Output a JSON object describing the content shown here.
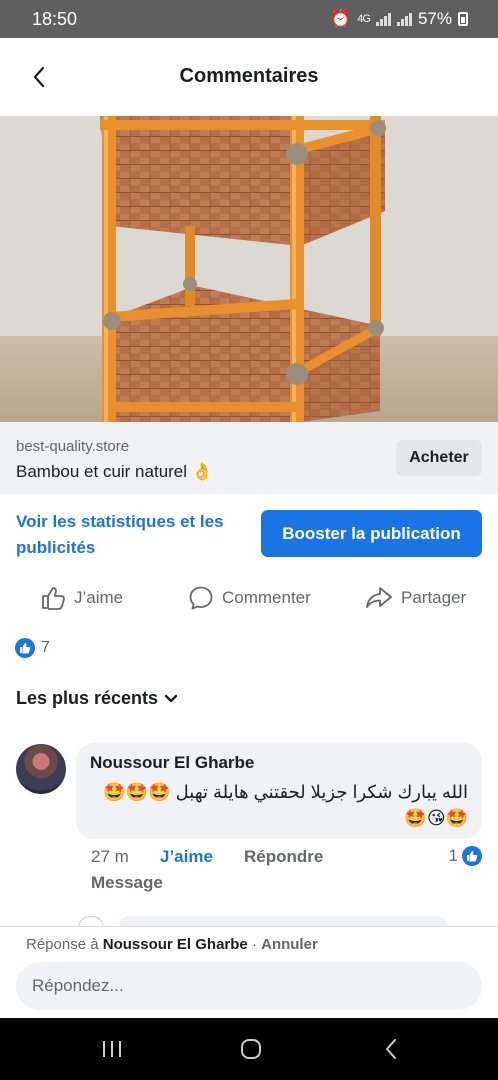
{
  "status_bar": {
    "time": "18:50",
    "network": "4G",
    "battery": "57%"
  },
  "header": {
    "title": "Commentaires"
  },
  "product": {
    "store": "best-quality.store",
    "name": "Bambou et cuir naturel 👌",
    "buy_label": "Acheter"
  },
  "promo": {
    "stats_label": "Voir les statistiques et les publicités",
    "boost_label": "Booster la publication"
  },
  "actions": {
    "like": "J’aime",
    "comment": "Commenter",
    "share": "Partager"
  },
  "reactions": {
    "count": "7"
  },
  "sort": {
    "label": "Les plus récents"
  },
  "comment": {
    "author": "Noussour El Gharbe",
    "text": "الله يبارك شكرا جزيلا لحقتني هايلة تهبل 🤩🤩🤩🤩😘🤩",
    "time": "27 m",
    "like_label": "J’aime",
    "reply_label": "Répondre",
    "message_label": "Message",
    "like_count": "1"
  },
  "reply_bar": {
    "prefix": "Réponse à",
    "name": "Noussour El Gharbe",
    "separator": "·",
    "cancel": "Annuler",
    "placeholder": "Répondez..."
  },
  "colors": {
    "accent": "#1b74e4",
    "status_bar": "#5f5f5f",
    "bubble": "#f0f2f5"
  },
  "icons": [
    "back-icon",
    "like-icon",
    "comment-icon",
    "share-icon",
    "chevron-down-icon",
    "recents-icon",
    "home-icon",
    "back-nav-icon"
  ]
}
